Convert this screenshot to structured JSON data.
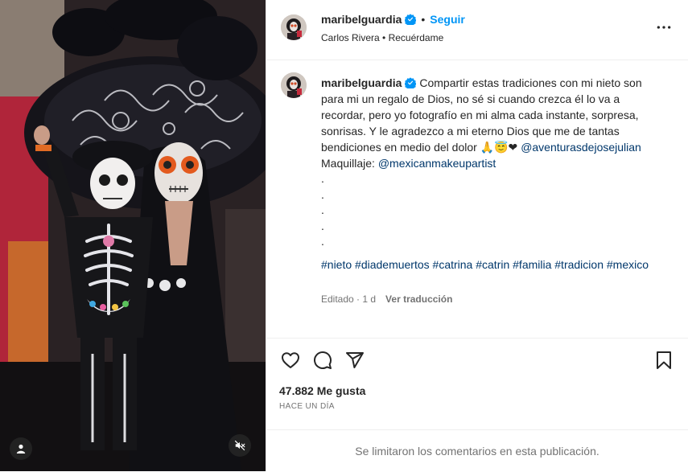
{
  "post": {
    "username": "maribelguardia",
    "follow_label": "Seguir",
    "dot": "•",
    "audio_artist": "Carlos Rivera",
    "audio_track": "Recuérdame",
    "audio_sep": "•",
    "caption": {
      "text_main": "Compartir estas tradiciones con mi nieto son para mi un regalo de Dios, no sé si cuando crezca él lo va a recordar, pero yo fotografío en mi alma cada instante, sorpresa, sonrisas. Y le agradezco a mi eterno Dios que me de tantas bendiciones en medio del dolor 🙏😇❤",
      "mention1": "@aventurasdejosejulian",
      "makeup_label": "Maquillaje:",
      "mention2": "@mexicanmakeupartist",
      "dots": [
        ".",
        ".",
        ".",
        ".",
        "."
      ],
      "hashtags": "#nieto #diademuertos #catrina #catrin #familia #tradicion #mexico"
    },
    "edited_label": "Editado · 1 d",
    "translate_label": "Ver traducción",
    "likes": "47.882 Me gusta",
    "time_ago": "HACE UN DÍA",
    "comments_disabled": "Se limitaron los comentarios en esta publicación."
  },
  "icons": {
    "verified": "verified-badge-icon",
    "more": "more-options-icon",
    "like": "heart-icon",
    "comment": "comment-icon",
    "share": "share-icon",
    "save": "bookmark-icon",
    "tag": "user-tag-icon",
    "mute": "muted-speaker-icon"
  },
  "colors": {
    "accent": "#0095f6",
    "link": "#00376b",
    "secondary_text": "#737373",
    "divider": "#efefef"
  }
}
